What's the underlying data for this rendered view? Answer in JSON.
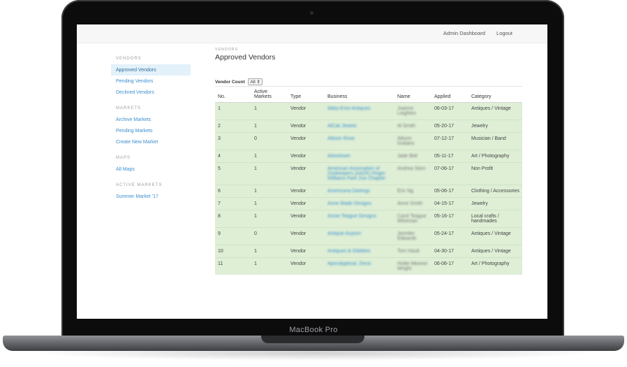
{
  "device": {
    "brand": "MacBook Pro"
  },
  "topbar": {
    "admin_label": "Admin Dashboard",
    "logout_label": "Logout"
  },
  "sidebar": {
    "sections": [
      {
        "heading": "VENDORS",
        "items": [
          {
            "label": "Approved Vendors",
            "active": true
          },
          {
            "label": "Pending Vendors",
            "active": false
          },
          {
            "label": "Declined Vendors",
            "active": false
          }
        ]
      },
      {
        "heading": "MARKETS",
        "items": [
          {
            "label": "Archive Markets",
            "active": false
          },
          {
            "label": "Pending Markets",
            "active": false
          },
          {
            "label": "Create New Market",
            "active": false
          }
        ]
      },
      {
        "heading": "MAPS",
        "items": [
          {
            "label": "All Maps",
            "active": false
          }
        ]
      },
      {
        "heading": "ACTIVE MARKETS",
        "items": [
          {
            "label": "Summer Market '17",
            "active": false
          }
        ]
      }
    ]
  },
  "main": {
    "breadcrumb": "VENDORS",
    "title": "Approved Vendors",
    "vendor_count_label": "Vendor Count",
    "vendor_count_value": "All",
    "columns": [
      "No.",
      "Active Markets",
      "Type",
      "Business",
      "Name",
      "Applied",
      "Category"
    ],
    "rows": [
      {
        "no": "1",
        "active": "1",
        "type": "Vendor",
        "business": "Abby-Emo Antiques",
        "name": "Joanne Leighton",
        "applied": "06-03-17",
        "category": "Antiques / Vintage"
      },
      {
        "no": "2",
        "active": "1",
        "type": "Vendor",
        "business": "AlCali Jewels",
        "name": "Al Smith",
        "applied": "05-20-17",
        "category": "Jewelry"
      },
      {
        "no": "3",
        "active": "0",
        "type": "Vendor",
        "business": "Allison Rose",
        "name": "Allison Gubans",
        "applied": "07-12-17",
        "category": "Musician / Band"
      },
      {
        "no": "4",
        "active": "1",
        "type": "Vendor",
        "business": "Alonetown",
        "name": "Jade Bell",
        "applied": "05-11-17",
        "category": "Art / Photography"
      },
      {
        "no": "5",
        "active": "1",
        "type": "Vendor",
        "business": "American Association of Zookeepers (AAZK) Roger Williams Park Zoo Chapter",
        "name": "Andrea Stein",
        "applied": "07-06-17",
        "category": "Non Profit"
      },
      {
        "no": "6",
        "active": "1",
        "type": "Vendor",
        "business": "Americana Darlings",
        "name": "Eric Ng",
        "applied": "05-06-17",
        "category": "Clothing / Accessories"
      },
      {
        "no": "7",
        "active": "1",
        "type": "Vendor",
        "business": "Anne Made Designs",
        "name": "Anne Smith",
        "applied": "04-15-17",
        "category": "Jewelry"
      },
      {
        "no": "8",
        "active": "1",
        "type": "Vendor",
        "business": "Annie Teague Designs",
        "name": "Carol Teague Wiseman",
        "applied": "05-16-17",
        "category": "Local crafts / handmades"
      },
      {
        "no": "9",
        "active": "0",
        "type": "Vendor",
        "business": "Antique Asylum",
        "name": "Jennifer Edwards",
        "applied": "05-24-17",
        "category": "Antiques / Vintage"
      },
      {
        "no": "10",
        "active": "1",
        "type": "Vendor",
        "business": "Antiques & Oddities",
        "name": "Tom Hault",
        "applied": "04-30-17",
        "category": "Antiques / Vintage"
      },
      {
        "no": "11",
        "active": "1",
        "type": "Vendor",
        "business": "Apocalyptical, Zenzi",
        "name": "Hollie Meanor Wright",
        "applied": "06-06-17",
        "category": "Art / Photography"
      }
    ]
  },
  "colors": {
    "row_bg": "#deefd6",
    "link": "#3a8fd0",
    "active_nav_bg": "#e3f1fa"
  }
}
